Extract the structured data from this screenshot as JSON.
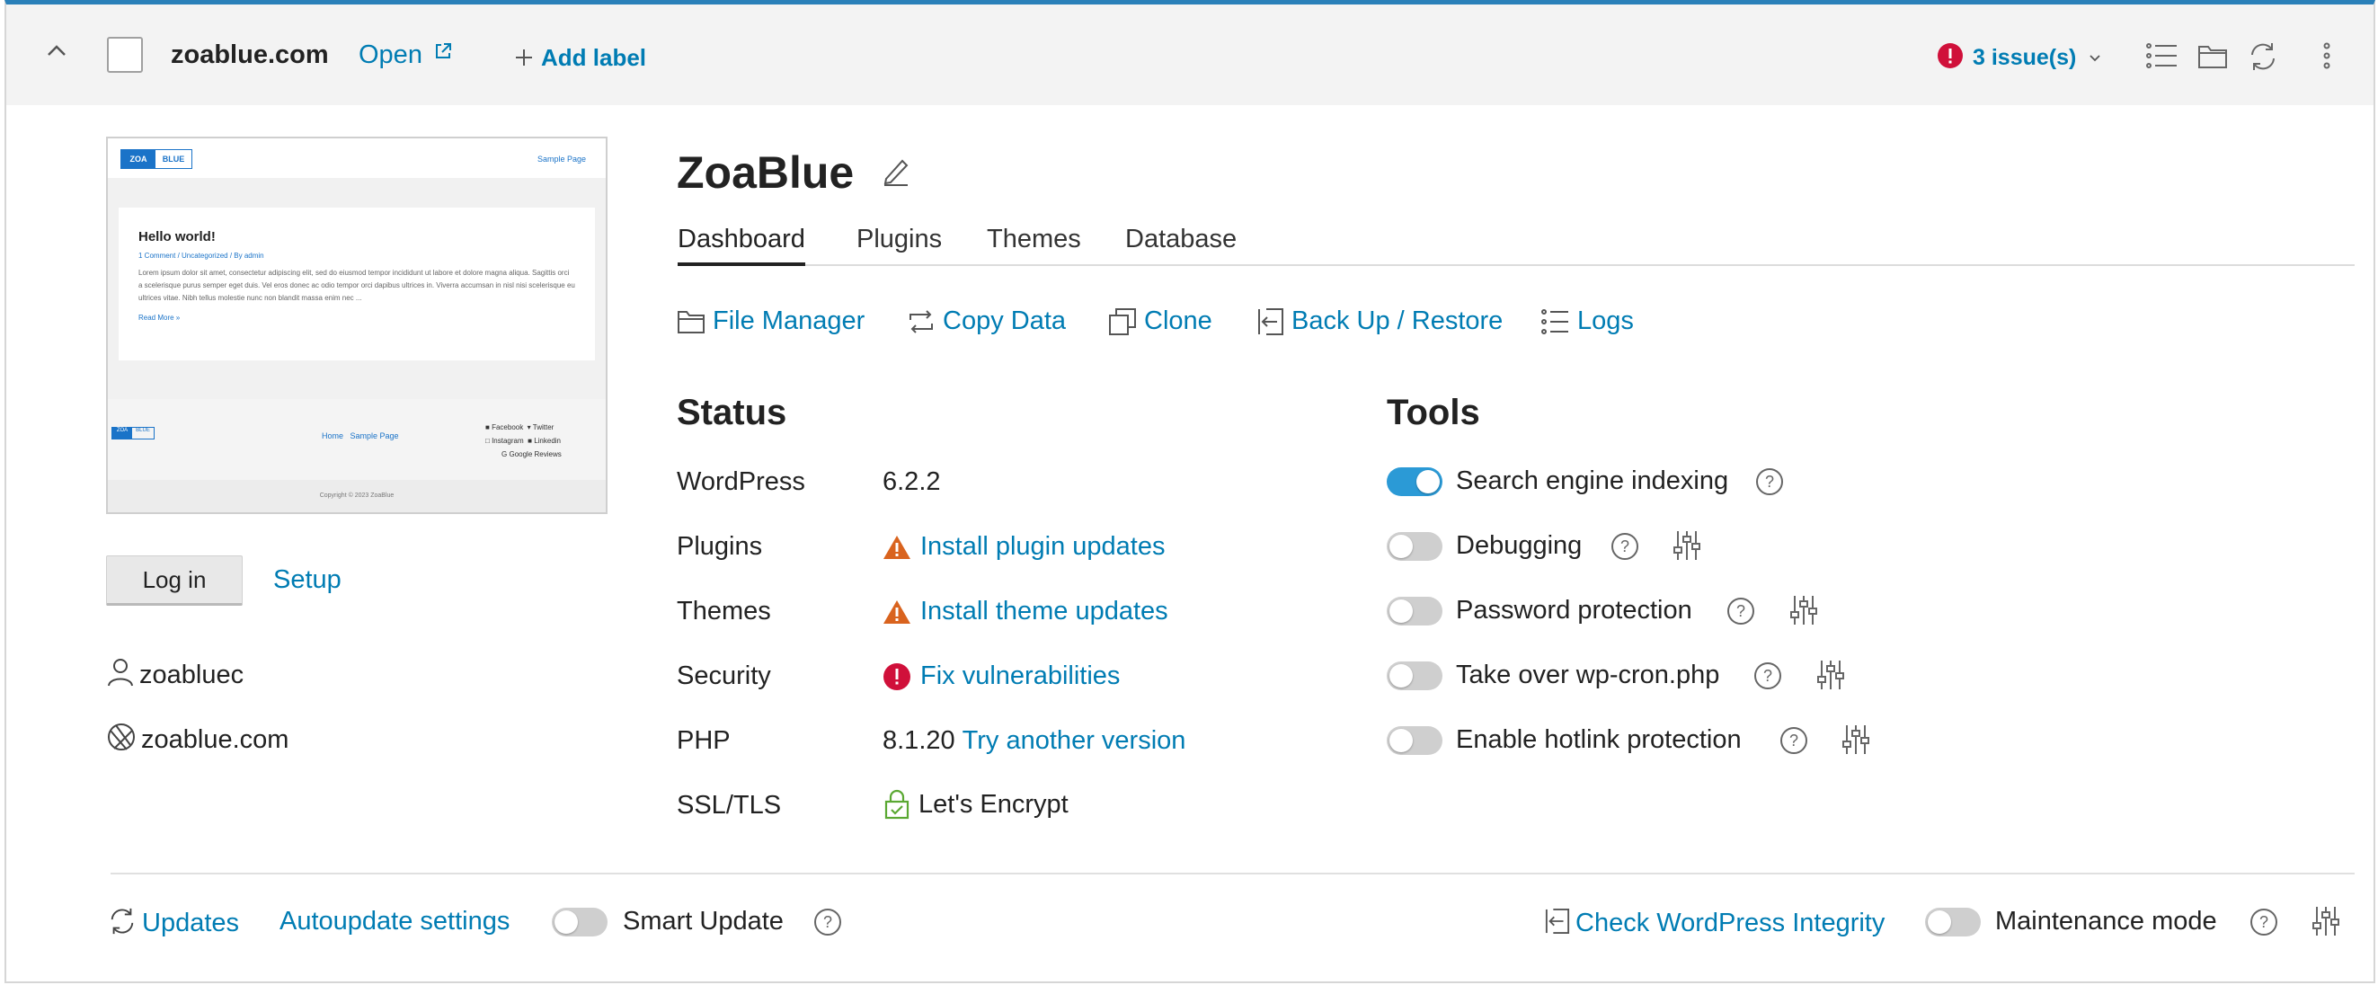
{
  "header": {
    "domain": "zoablue.com",
    "open_label": "Open",
    "add_label": "Add label",
    "issues_label": "3 issue(s)"
  },
  "preview": {
    "logo_left": "ZOA",
    "logo_right": "BLUE",
    "nav_link": "Sample Page",
    "post_title": "Hello world!",
    "post_meta": "1 Comment / Uncategorized / By admin",
    "post_excerpt": "Lorem ipsum dolor sit amet, consectetur adipiscing elit, sed do eiusmod tempor incididunt ut labore et dolore magna aliqua. Sagittis orci a scelerisque purus semper eget duis. Vel eros donec ac odio tempor orci dapibus ultrices in. Viverra accumsan in nisl nisi scelerisque eu ultrices vitae. Nibh tellus molestie nunc non blandit massa enim nec ...",
    "read_more": "Read More »",
    "footer_nav_home": "Home",
    "footer_nav_sample": "Sample Page",
    "social_facebook": "Facebook",
    "social_twitter": "Twitter",
    "social_instagram": "Instagram",
    "social_linkedin": "Linkedin",
    "social_google": "Google Reviews",
    "copyright": "Copyright © 2023 ZoaBlue"
  },
  "left": {
    "login_label": "Log in",
    "setup_label": "Setup",
    "username": "zoabluec",
    "site_domain": "zoablue.com"
  },
  "main": {
    "title": "ZoaBlue",
    "tabs": [
      {
        "label": "Dashboard"
      },
      {
        "label": "Plugins"
      },
      {
        "label": "Themes"
      },
      {
        "label": "Database"
      }
    ],
    "actions": {
      "file_manager": "File Manager",
      "copy_data": "Copy Data",
      "clone": "Clone",
      "backup": "Back Up / Restore",
      "logs": "Logs"
    }
  },
  "status": {
    "heading": "Status",
    "rows": [
      {
        "label": "WordPress",
        "value": "6.2.2"
      },
      {
        "label": "Plugins",
        "value": "Install plugin updates"
      },
      {
        "label": "Themes",
        "value": "Install theme updates"
      },
      {
        "label": "Security",
        "value": "Fix vulnerabilities"
      },
      {
        "label": "PHP",
        "value": "8.1.20",
        "link": "Try another version"
      },
      {
        "label": "SSL/TLS",
        "value": "Let's Encrypt"
      }
    ]
  },
  "tools": {
    "heading": "Tools",
    "items": [
      {
        "label": "Search engine indexing",
        "enabled": true
      },
      {
        "label": "Debugging",
        "enabled": false
      },
      {
        "label": "Password protection",
        "enabled": false
      },
      {
        "label": "Take over wp-cron.php",
        "enabled": false
      },
      {
        "label": "Enable hotlink protection",
        "enabled": false
      }
    ]
  },
  "footer": {
    "updates": "Updates",
    "autoupdate": "Autoupdate settings",
    "smart_update": "Smart Update",
    "integrity": "Check WordPress Integrity",
    "maintenance": "Maintenance mode"
  },
  "colors": {
    "link": "#007cb3",
    "accent_bar": "#2a80b9",
    "toggle_on": "#2b9ad6",
    "error": "#d0103a",
    "warning": "#d9631e",
    "ssl_ok": "#5aa832"
  }
}
